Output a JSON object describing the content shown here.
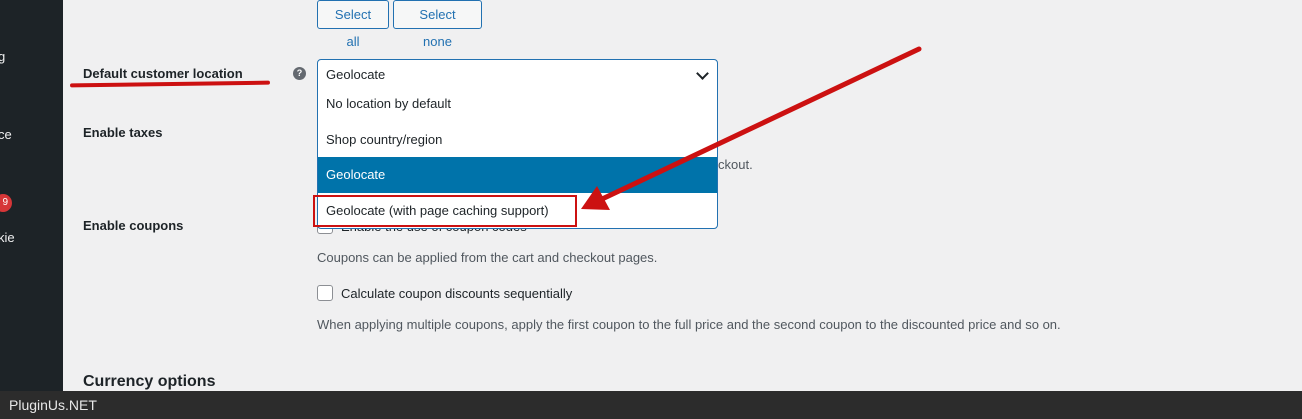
{
  "sidebar": {
    "fragments": [
      "g",
      "ce",
      "kie"
    ],
    "badge": "9"
  },
  "buttons": {
    "select_all": "Select all",
    "select_none": "Select none"
  },
  "labels": {
    "default_location": "Default customer location",
    "enable_taxes": "Enable taxes",
    "enable_coupons": "Enable coupons"
  },
  "help_icon": "help-icon",
  "select": {
    "current": "Geolocate",
    "options": [
      "No location by default",
      "Shop country/region",
      "Geolocate",
      "Geolocate (with page caching support)"
    ],
    "selected_index": 2
  },
  "taxes_desc_fragment": "ckout.",
  "coupons": {
    "checkbox1_label": "Enable the use of coupon codes",
    "desc1": "Coupons can be applied from the cart and checkout pages.",
    "checkbox2_label": "Calculate coupon discounts sequentially",
    "desc2": "When applying multiple coupons, apply the first coupon to the full price and the second coupon to the discounted price and so on."
  },
  "section_title": "Currency options",
  "footer": "PluginUs.NET",
  "colors": {
    "annotation_red": "#cc1111",
    "selected_option": "#0073aa",
    "link_blue": "#2271b1"
  }
}
